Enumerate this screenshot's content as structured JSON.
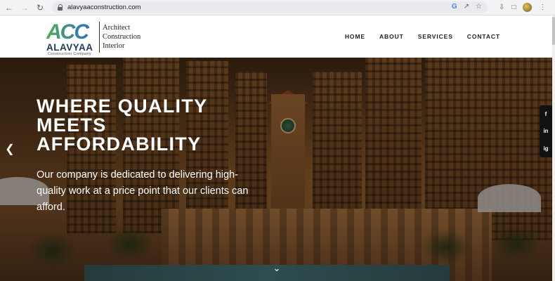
{
  "browser": {
    "url": "alavyaaconstruction.com",
    "back_icon": "arrow-left-icon",
    "forward_icon": "arrow-right-icon",
    "reload_icon": "reload-icon"
  },
  "header": {
    "logo_mark": "ACC",
    "brand": "ALAVYAA",
    "brand_sub": "Construction Company",
    "tagline_lines": [
      "Architect",
      "Construction",
      "Interior"
    ],
    "nav": [
      "HOME",
      "ABOUT",
      "SERVICES",
      "CONTACT"
    ]
  },
  "hero": {
    "title_lines": [
      "WHERE QUALITY",
      "MEETS",
      "AFFORDABILITY"
    ],
    "text": "Our company is dedicated to delivering high-quality work at a price point that our clients can afford."
  },
  "social": [
    "f",
    "in",
    "ig"
  ],
  "colors": {
    "logo_blue": "#2f6fc2",
    "logo_green": "#4caf50",
    "brand_navy": "#1f3a5f",
    "hero_text": "#ffffff"
  }
}
